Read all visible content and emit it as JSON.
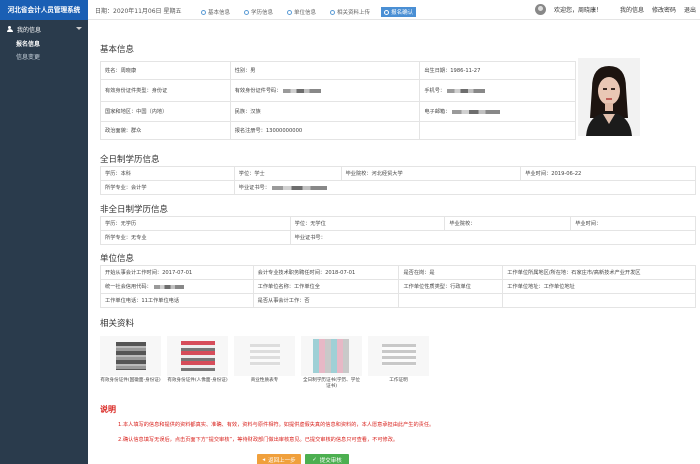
{
  "app": {
    "title": "河北省会计人员管理系统",
    "date": "日期：2020年11月06日 星期五"
  },
  "user": {
    "welcome": "欢迎您，周晓康！",
    "my_info": "我的信息",
    "change_pwd": "修改密码",
    "logout": "退出"
  },
  "sidebar": {
    "group": "我的信息",
    "items": [
      {
        "label": "报名信息"
      },
      {
        "label": "信息变更"
      }
    ]
  },
  "steps": [
    {
      "label": "基本信息"
    },
    {
      "label": "学历信息"
    },
    {
      "label": "单位信息"
    },
    {
      "label": "相关资料上传"
    },
    {
      "label": "报名确认"
    }
  ],
  "basic": {
    "title": "基本信息",
    "name": "姓名：周晓康",
    "gender": "性别：男",
    "birth": "出生日期：1986-11-27",
    "id_type": "有效身份证件类型：身份证",
    "id_no": "有效身份证件号码：",
    "phone": "手机号：",
    "country": "国家和地区：中国（内地）",
    "ethnic": "民族：汉族",
    "email": "电子邮箱：",
    "politics": "政治面貌：群众",
    "reg_no": "报名注册号：13000000000"
  },
  "fulltime": {
    "title": "全日制学历信息",
    "degree": "学历：本科",
    "xuewei": "学位：学士",
    "school": "毕业院校：河北经贸大学",
    "grad_time": "毕业时间：2019-06-22",
    "major": "所学专业：会计学",
    "cert": "毕业证书号："
  },
  "parttime": {
    "title": "非全日制学历信息",
    "degree": "学历：无学历",
    "xuewei": "学位：无学位",
    "school": "毕业院校：",
    "grad_time": "毕业时间：",
    "major": "所学专业：无专业",
    "cert": "毕业证书号："
  },
  "unit": {
    "title": "单位信息",
    "start_work": "开始从事会计工作时间：2017-07-01",
    "cert_time": "会计专业技术职务聘任时间：2018-07-01",
    "on_job": "是否在岗：是",
    "region": "工作单位所属地区/所在地：石家庄市/高新技术产业开发区",
    "credit_code": "统一社会信用代码：",
    "unit_name": "工作单位名称：工作单位全",
    "unit_type": "工作单位性质类型：行政单位",
    "unit_addr": "工作单位地址：工作单位地址",
    "unit_phone": "工作单位电话：11工作单位电话",
    "accounting": "是否从事会计工作：否"
  },
  "docs": {
    "title": "相关资料",
    "items": [
      {
        "caption": "有效身份证件(国徽面-身份证)"
      },
      {
        "caption": "有效身份证件(人像面-身份证)"
      },
      {
        "caption": "商业性质表专"
      },
      {
        "caption": "全日制学历证书(学历、学位证书)"
      },
      {
        "caption": "工作证明"
      }
    ]
  },
  "notes": {
    "title": "说明",
    "line1": "1.本人填写的信息和提供的资料都真实、准确、有效，资料与原件相符。如提供虚假失真的信息和资料的，本人愿意承担由此产生的责任。",
    "line2": "2.确认信息填写无误后，点击页面下方“提交审核”，等待财政部门做出审核意见。已提交审核的信息只可查看，不可修改。"
  },
  "buttons": {
    "back": "返回上一步",
    "submit": "提交审核"
  },
  "colors": {
    "brand": "#1a5fb4",
    "sidebar": "#2a3b4c",
    "warn": "#d9231e",
    "back_btn": "#f0a03c",
    "submit_btn": "#4caf50"
  }
}
